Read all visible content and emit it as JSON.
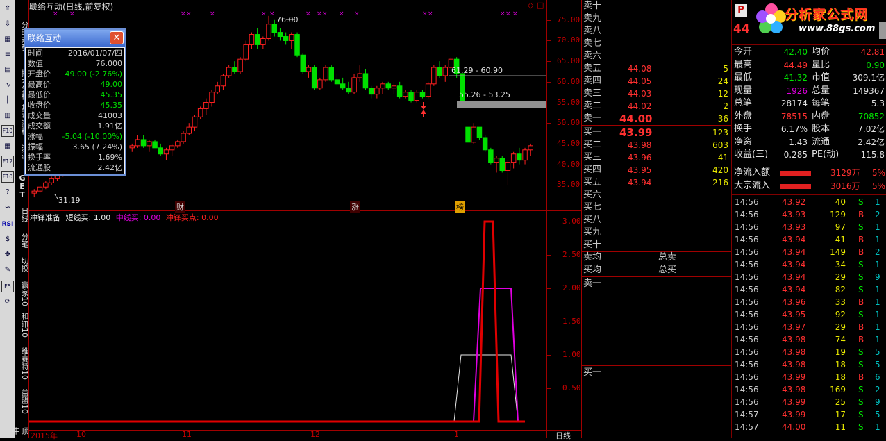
{
  "window": {
    "title": "联络互动(日线,前复权)"
  },
  "toolbar_icons": [
    "up-arrow-icon",
    "down-arrow-icon",
    "calc-icon",
    "list-icon",
    "grid-icon",
    "line-chart-icon",
    "candle-icon",
    "bar-chart-icon",
    "f10-icon",
    "table-icon",
    "f12-icon",
    "f10-alt-icon",
    "help-icon",
    "zigzag-icon",
    "rsi-icon",
    "money-icon",
    "move-icon",
    "pencil-icon",
    "f5-icon",
    "refresh-icon"
  ],
  "rsi_label": "RSI",
  "vertical_tabs": [
    "分时走势",
    "技术分析",
    "基本资料",
    "沪深"
  ],
  "period_buttons": [
    "日线",
    "分笔",
    "切换",
    "赢家10",
    "和讯10",
    "维赛特10",
    "益盟10",
    "顶牛"
  ],
  "period_nums": [
    "1",
    "5",
    "15",
    "30",
    "60"
  ],
  "letters": [
    "G",
    "E",
    "T"
  ],
  "kline": {
    "price_axis": [
      "75.00",
      "70.00",
      "65.00",
      "60.00",
      "55.00",
      "50.00",
      "45.00",
      "40.00",
      "35.00"
    ],
    "annotation_high": "76.00",
    "annotation_low": "31.19",
    "band1_label": "61.29 - 60.90",
    "band2_label": "55.26 - 53.25",
    "event_labels": [
      "财",
      "涨",
      "榜"
    ],
    "corner_icons": [
      "◇",
      "□"
    ]
  },
  "popup": {
    "title": "联络互动",
    "close": "✕",
    "rows": [
      {
        "label": "时间",
        "value": "2016/01/07/四",
        "color": "#d0d0d0"
      },
      {
        "label": "数值",
        "value": "76.000",
        "color": "#d0d0d0"
      },
      {
        "label": "开盘价",
        "value": "49.00 (-2.76%)",
        "color": "#00e000"
      },
      {
        "label": "最高价",
        "value": "49.00",
        "color": "#00e000"
      },
      {
        "label": "最低价",
        "value": "45.35",
        "color": "#00e000"
      },
      {
        "label": "收盘价",
        "value": "45.35",
        "color": "#00e000"
      },
      {
        "label": "成交量",
        "value": "41003",
        "color": "#d0d0d0"
      },
      {
        "label": "成交额",
        "value": "1.91亿",
        "color": "#d0d0d0"
      },
      {
        "label": "涨幅",
        "value": "-5.04 (-10.00%)",
        "color": "#00e000"
      },
      {
        "label": "振幅",
        "value": "3.65 (7.24%)",
        "color": "#d0d0d0"
      },
      {
        "label": "换手率",
        "value": "1.69%",
        "color": "#d0d0d0"
      },
      {
        "label": "流通股",
        "value": "2.42亿",
        "color": "#d0d0d0"
      }
    ]
  },
  "indicator": {
    "name": "冲锋准备",
    "items": [
      {
        "text": "短线买: 1.00",
        "color": "#e8e8e8"
      },
      {
        "text": "中线买: 0.00",
        "color": "#e000e0"
      },
      {
        "text": "冲锋买点: 0.00",
        "color": "#ff2020"
      }
    ],
    "axis": [
      "3.00",
      "2.50",
      "2.00",
      "1.50",
      "1.00",
      "0.50"
    ]
  },
  "xaxis": {
    "labels": [
      "2015年",
      "10",
      "11",
      "12",
      "1"
    ],
    "period_label": "日线"
  },
  "orderbook": {
    "sell": [
      {
        "label": "卖十",
        "price": "",
        "vol": ""
      },
      {
        "label": "卖九",
        "price": "",
        "vol": ""
      },
      {
        "label": "卖八",
        "price": "",
        "vol": ""
      },
      {
        "label": "卖七",
        "price": "",
        "vol": ""
      },
      {
        "label": "卖六",
        "price": "",
        "vol": ""
      },
      {
        "label": "卖五",
        "price": "44.08",
        "vol": "5"
      },
      {
        "label": "卖四",
        "price": "44.05",
        "vol": "24"
      },
      {
        "label": "卖三",
        "price": "44.03",
        "vol": "12"
      },
      {
        "label": "卖二",
        "price": "44.02",
        "vol": "2"
      },
      {
        "label": "卖一",
        "price": "44.00",
        "vol": "36"
      }
    ],
    "buy": [
      {
        "label": "买一",
        "price": "43.99",
        "vol": "123"
      },
      {
        "label": "买二",
        "price": "43.98",
        "vol": "603"
      },
      {
        "label": "买三",
        "price": "43.96",
        "vol": "41"
      },
      {
        "label": "买四",
        "price": "43.95",
        "vol": "420"
      },
      {
        "label": "买五",
        "price": "43.94",
        "vol": "216"
      },
      {
        "label": "买六",
        "price": "",
        "vol": ""
      },
      {
        "label": "买七",
        "price": "",
        "vol": ""
      },
      {
        "label": "买八",
        "price": "",
        "vol": ""
      },
      {
        "label": "买九",
        "price": "",
        "vol": ""
      },
      {
        "label": "买十",
        "price": "",
        "vol": ""
      }
    ],
    "avg_sell": "卖均",
    "total_sell": "总卖",
    "avg_buy": "买均",
    "total_buy": "总买",
    "queue_sell": "卖一",
    "queue_buy": "买一"
  },
  "brand": {
    "name": "分析家公式网",
    "url": "www.88gs.com",
    "code_prefix": "44",
    "p_badge": "P"
  },
  "stats": [
    {
      "l1": "今开",
      "v1": "42.40",
      "c1": "#00e000",
      "l2": "均价",
      "v2": "42.81",
      "c2": "#ff3030"
    },
    {
      "l1": "最高",
      "v1": "44.49",
      "c1": "#ff3030",
      "l2": "量比",
      "v2": "0.90",
      "c2": "#00e000"
    },
    {
      "l1": "最低",
      "v1": "41.32",
      "c1": "#00e000",
      "l2": "市值",
      "v2": "309.1亿",
      "c2": "#e0e0e0"
    },
    {
      "l1": "现量",
      "v1": "1926",
      "c1": "#e000e0",
      "l2": "总量",
      "v2": "149367",
      "c2": "#e0e0e0"
    },
    {
      "l1": "总笔",
      "v1": "28174",
      "c1": "#e0e0e0",
      "l2": "每笔",
      "v2": "5.3",
      "c2": "#e0e0e0"
    },
    {
      "l1": "外盘",
      "v1": "78515",
      "c1": "#ff3030",
      "l2": "内盘",
      "v2": "70852",
      "c2": "#00e000"
    },
    {
      "l1": "换手",
      "v1": "6.17%",
      "c1": "#e0e0e0",
      "l2": "股本",
      "v2": "7.02亿",
      "c2": "#e0e0e0"
    },
    {
      "l1": "净资",
      "v1": "1.43",
      "c1": "#e0e0e0",
      "l2": "流通",
      "v2": "2.42亿",
      "c2": "#e0e0e0"
    },
    {
      "l1": "收益(三)",
      "v1": "0.285",
      "c1": "#e0e0e0",
      "l2": "PE(动)",
      "v2": "115.8",
      "c2": "#e0e0e0"
    }
  ],
  "flows": [
    {
      "label": "净流入额",
      "value": "3129万",
      "pct": "5%"
    },
    {
      "label": "大宗流入",
      "value": "3016万",
      "pct": "5%"
    }
  ],
  "ticks": [
    {
      "time": "14:56",
      "price": "43.92",
      "vol": "40",
      "side": "S",
      "n": "1"
    },
    {
      "time": "14:56",
      "price": "43.93",
      "vol": "129",
      "side": "B",
      "n": "2"
    },
    {
      "time": "14:56",
      "price": "43.93",
      "vol": "97",
      "side": "S",
      "n": "1"
    },
    {
      "time": "14:56",
      "price": "43.94",
      "vol": "41",
      "side": "B",
      "n": "1"
    },
    {
      "time": "14:56",
      "price": "43.94",
      "vol": "149",
      "side": "B",
      "n": "2"
    },
    {
      "time": "14:56",
      "price": "43.94",
      "vol": "34",
      "side": "S",
      "n": "1"
    },
    {
      "time": "14:56",
      "price": "43.94",
      "vol": "29",
      "side": "S",
      "n": "9"
    },
    {
      "time": "14:56",
      "price": "43.94",
      "vol": "82",
      "side": "S",
      "n": "1"
    },
    {
      "time": "14:56",
      "price": "43.96",
      "vol": "33",
      "side": "B",
      "n": "1"
    },
    {
      "time": "14:56",
      "price": "43.95",
      "vol": "92",
      "side": "S",
      "n": "1"
    },
    {
      "time": "14:56",
      "price": "43.97",
      "vol": "29",
      "side": "B",
      "n": "1"
    },
    {
      "time": "14:56",
      "price": "43.98",
      "vol": "74",
      "side": "B",
      "n": "1"
    },
    {
      "time": "14:56",
      "price": "43.98",
      "vol": "19",
      "side": "S",
      "n": "5"
    },
    {
      "time": "14:56",
      "price": "43.98",
      "vol": "18",
      "side": "S",
      "n": "5"
    },
    {
      "time": "14:56",
      "price": "43.99",
      "vol": "18",
      "side": "B",
      "n": "6"
    },
    {
      "time": "14:56",
      "price": "43.98",
      "vol": "169",
      "side": "S",
      "n": "2"
    },
    {
      "time": "14:56",
      "price": "43.99",
      "vol": "25",
      "side": "S",
      "n": "9"
    },
    {
      "time": "14:57",
      "price": "43.99",
      "vol": "17",
      "side": "S",
      "n": "5"
    },
    {
      "time": "14:57",
      "price": "44.00",
      "vol": "11",
      "side": "S",
      "n": "1"
    }
  ],
  "candles": [
    [
      33,
      34,
      32,
      33.5
    ],
    [
      33.5,
      35,
      33,
      34.5
    ],
    [
      34.5,
      36,
      34,
      35.5
    ],
    [
      35.5,
      37,
      35,
      36.5
    ],
    [
      36.5,
      38,
      36,
      37.5
    ],
    [
      37.5,
      39,
      37,
      38.5
    ],
    [
      38.5,
      40,
      38,
      38
    ],
    [
      44,
      45,
      43,
      44.5
    ],
    [
      44.5,
      47,
      44,
      46
    ],
    [
      46,
      47,
      44,
      44.5
    ],
    [
      44.5,
      46,
      43,
      45.5
    ],
    [
      45.5,
      46,
      44,
      44
    ],
    [
      44,
      45,
      42,
      42.5
    ],
    [
      42.5,
      44,
      41,
      43.5
    ],
    [
      43.5,
      45,
      42,
      44.5
    ],
    [
      44.5,
      46,
      44,
      45.5
    ],
    [
      45.5,
      48,
      45,
      47.5
    ],
    [
      47.5,
      50,
      47,
      49
    ],
    [
      49,
      52,
      48,
      51.5
    ],
    [
      51.5,
      54,
      51,
      53.5
    ],
    [
      53.5,
      56,
      52,
      55
    ],
    [
      55,
      58,
      54,
      57.5
    ],
    [
      57.5,
      60,
      57,
      59
    ],
    [
      59,
      62,
      58,
      61.5
    ],
    [
      61.5,
      64,
      61,
      63.5
    ],
    [
      63.5,
      65,
      62,
      62.5
    ],
    [
      62.5,
      66,
      62,
      65.5
    ],
    [
      65.5,
      70,
      65,
      69
    ],
    [
      69,
      72,
      68,
      71.5
    ],
    [
      71.5,
      73,
      68,
      69
    ],
    [
      69,
      71,
      68,
      70.5
    ],
    [
      70.5,
      76,
      70,
      74
    ],
    [
      74,
      75,
      71,
      72
    ],
    [
      72,
      73,
      70,
      71
    ],
    [
      71,
      72,
      69,
      70
    ],
    [
      70,
      72,
      68,
      71.5
    ],
    [
      71.5,
      72,
      66,
      66.5
    ],
    [
      66.5,
      67,
      62,
      62.5
    ],
    [
      62.5,
      64,
      61,
      63.5
    ],
    [
      63.5,
      64,
      58,
      58.5
    ],
    [
      58.5,
      61,
      58,
      60.5
    ],
    [
      60.5,
      64,
      60,
      63.5
    ],
    [
      63.5,
      64,
      60,
      60.5
    ],
    [
      60.5,
      62,
      59,
      59.5
    ],
    [
      59.5,
      61,
      58,
      58.5
    ],
    [
      58.5,
      60,
      57,
      57.5
    ],
    [
      57.5,
      62,
      57,
      61
    ],
    [
      61,
      64,
      60,
      62
    ],
    [
      62,
      63,
      58,
      58.5
    ],
    [
      58.5,
      59,
      56,
      57
    ],
    [
      57,
      59,
      56,
      58.5
    ],
    [
      58.5,
      60,
      57,
      59.5
    ],
    [
      59.5,
      60,
      58,
      58.5
    ],
    [
      58.5,
      60,
      57,
      59
    ],
    [
      59,
      60,
      56,
      56.5
    ],
    [
      56.5,
      58,
      56,
      57.5
    ],
    [
      57.5,
      58,
      55,
      55.5
    ],
    [
      55.5,
      58,
      55,
      57.5
    ],
    [
      57.5,
      58,
      56,
      56.5
    ],
    [
      56.5,
      60,
      56,
      59.5
    ],
    [
      59.5,
      64,
      59,
      63.5
    ],
    [
      63.5,
      65,
      61,
      61.5
    ],
    [
      61.5,
      64,
      60,
      63.5
    ],
    [
      63.5,
      66,
      63,
      65.5
    ],
    [
      65.5,
      66,
      61,
      62
    ],
    [
      62,
      62,
      55,
      55.5
    ],
    [
      49,
      49,
      45.35,
      45.35
    ],
    [
      45.35,
      50,
      45,
      49
    ],
    [
      49,
      49,
      46,
      46.5
    ],
    [
      46.5,
      47,
      43,
      43.5
    ],
    [
      43.5,
      44,
      40,
      40.5
    ],
    [
      40.5,
      42,
      38,
      41.5
    ],
    [
      41.5,
      42,
      38,
      38.5
    ],
    [
      38.5,
      41,
      35,
      40.5
    ],
    [
      40.5,
      43,
      39,
      42.5
    ],
    [
      42.5,
      44,
      40,
      41
    ],
    [
      41,
      44,
      40,
      43.5
    ],
    [
      43.5,
      45,
      42,
      44.5
    ]
  ]
}
